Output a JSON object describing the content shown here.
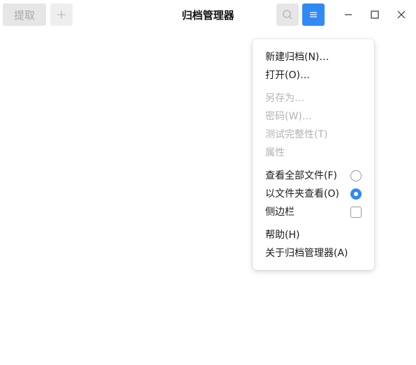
{
  "header": {
    "extract_label": "提取",
    "add_icon": "plus-icon",
    "title": "归档管理器",
    "search_icon": "search-icon",
    "menu_icon": "hamburger-menu-icon",
    "accent_color": "#2f8af5"
  },
  "window_controls": {
    "minimize_icon": "minimize-icon",
    "maximize_icon": "maximize-icon",
    "close_icon": "close-icon"
  },
  "menu": {
    "items": [
      {
        "label": "新建归档(N)…",
        "enabled": true
      },
      {
        "label": "打开(O)…",
        "enabled": true
      },
      {
        "label": "另存为…",
        "enabled": false
      },
      {
        "label": "密码(W)…",
        "enabled": false
      },
      {
        "label": "测试完整性(T)",
        "enabled": false
      },
      {
        "label": "属性",
        "enabled": false
      },
      {
        "label": "查看全部文件(F)",
        "enabled": true,
        "control": "radio",
        "checked": false
      },
      {
        "label": "以文件夹查看(O)",
        "enabled": true,
        "control": "radio",
        "checked": true
      },
      {
        "label": "侧边栏",
        "enabled": true,
        "control": "checkbox",
        "checked": false
      },
      {
        "label": "帮助(H)",
        "enabled": true
      },
      {
        "label": "关于归档管理器(A)",
        "enabled": true
      }
    ]
  }
}
